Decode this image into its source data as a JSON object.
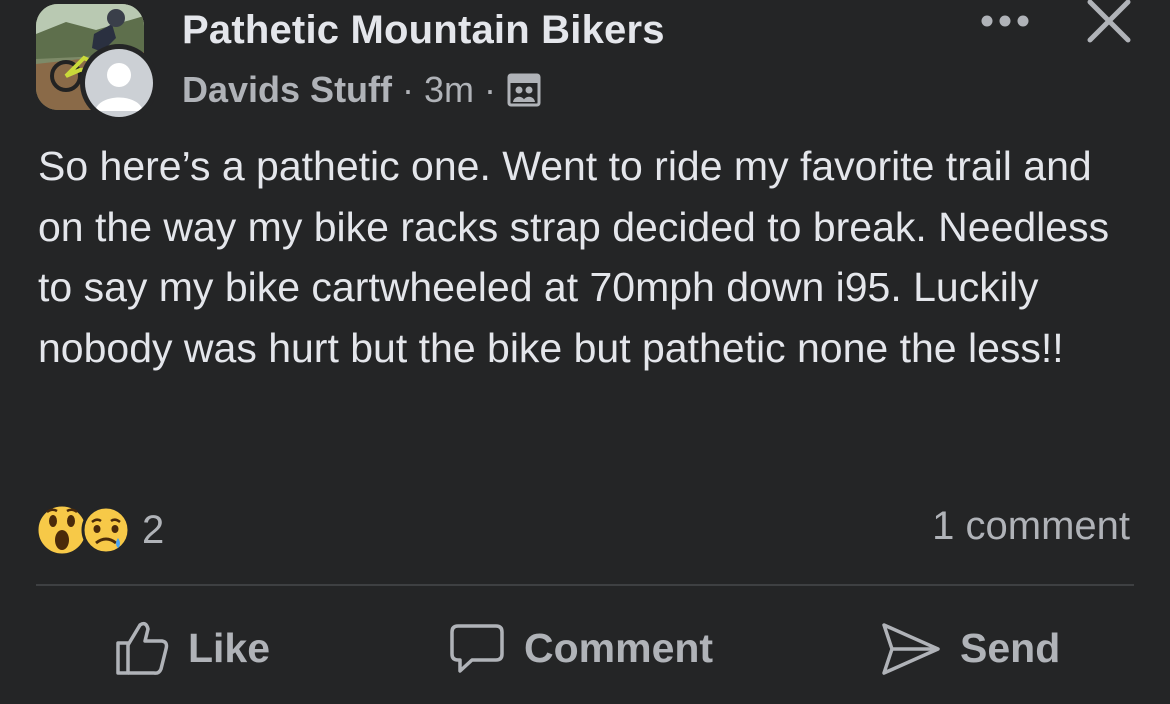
{
  "post": {
    "group_name": "Pathetic Mountain Bikers",
    "author": "Davids Stuff",
    "separator": "·",
    "time": "3m",
    "text": "So here’s a pathetic one. Went to ride my favorite trail and on the way my bike racks strap decided to break. Needless to say my bike cartwheeled at 70mph down i95. Luckily nobody was hurt but the bike but pathetic none the less!!",
    "reactions": {
      "icons": [
        "wow-reaction-icon",
        "sad-reaction-icon"
      ],
      "count": "2"
    },
    "comment_count": "1 comment"
  },
  "actions": {
    "like": "Like",
    "comment": "Comment",
    "send": "Send"
  },
  "colors": {
    "background": "#242526",
    "primary_text": "#e4e6eb",
    "secondary_text": "#b0b3b8",
    "divider": "#3e4042"
  }
}
